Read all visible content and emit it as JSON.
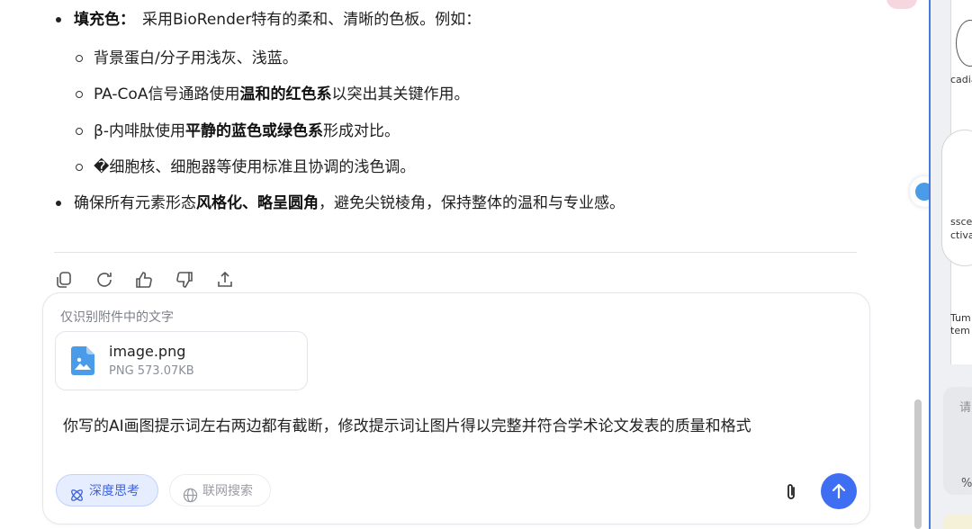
{
  "bullets": {
    "fill": {
      "label": "填充色：",
      "text": "采用BioRender特有的柔和、清晰的色板。例如："
    },
    "sub1": "背景蛋白/分子用浅灰、浅蓝。",
    "sub2": {
      "pre": "PA-CoA信号通路使用",
      "bold": "温和的红色系",
      "post": "以突出其关键作用。"
    },
    "sub3": {
      "pre": "β-内啡肽使用",
      "bold": "平静的蓝色或绿色系",
      "post": "形成对比。"
    },
    "sub4": "�细胞核、细胞器等使用标准且协调的浅色调。",
    "style": {
      "pre": "确保所有元素形态",
      "bold": "风格化、略呈圆角",
      "post": "，避免尖锐棱角，保持整体的温和与专业感。"
    }
  },
  "actions": [
    "copy-icon",
    "regenerate-icon",
    "thumbs-up-icon",
    "thumbs-down-icon",
    "share-icon"
  ],
  "composer": {
    "hint": "仅识别附件中的文字",
    "file": {
      "name": "image.png",
      "meta": "PNG 573.07KB",
      "icon": "image-file-icon"
    },
    "text": "你写的AI画图提示词左右两边都有截断，修改提示词让图片得以完整并符合学术论文发表的质量和格式",
    "deep_think": "深度思考",
    "web_search": "联网搜索"
  },
  "right_panel": {
    "t1": "cadia",
    "t2a": "sscen",
    "t2b": "ctiva",
    "t3a": "Tum",
    "t3b": "tem",
    "input_char": "请",
    "percent": "%"
  },
  "colors": {
    "accent": "#3e6ff3",
    "chip_bg": "#e6edff",
    "chip_text": "#3d63dd",
    "file_icon": "#4a9be8"
  }
}
